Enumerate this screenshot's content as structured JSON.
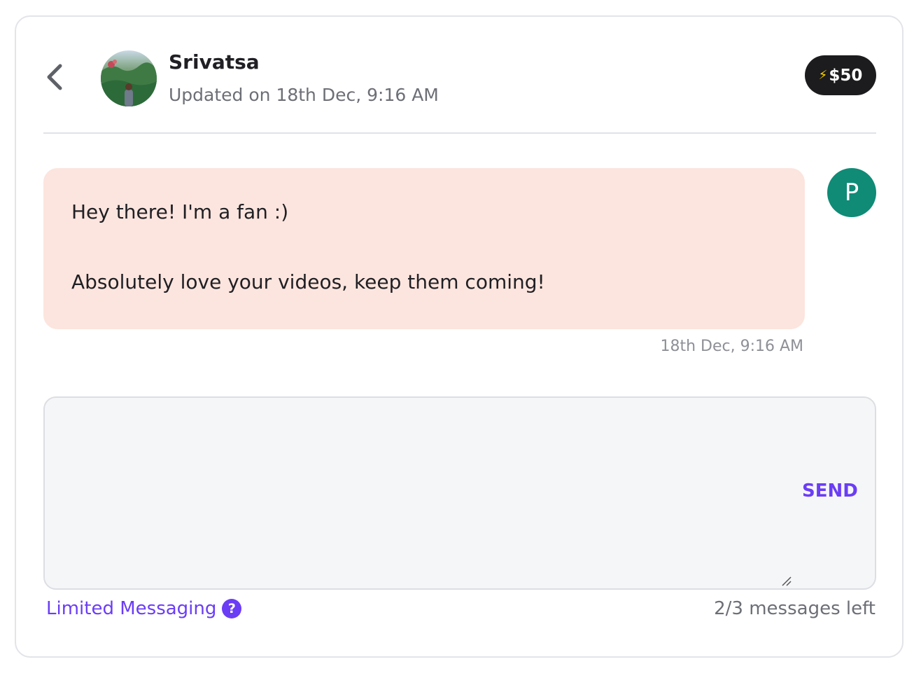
{
  "header": {
    "name": "Srivatsa",
    "updated": "Updated on 18th Dec, 9:16 AM",
    "amount": "$50",
    "back_icon": "chevron-left-icon",
    "avatar_icon": "profile-photo"
  },
  "message": {
    "line1": "Hey there! I'm a fan :)",
    "line2": "Absolutely love your videos, keep them coming!",
    "timestamp": "18th Dec, 9:16 AM",
    "sender_initial": "P"
  },
  "compose": {
    "value": "",
    "send_label": "SEND"
  },
  "footer": {
    "limited_label": "Limited Messaging",
    "help_icon": "?",
    "messages_left": "2/3 messages left"
  },
  "colors": {
    "accent": "#6b3df5",
    "bubble": "#fce5de",
    "sender_avatar": "#0f8b76",
    "badge": "#1c1c1e"
  }
}
